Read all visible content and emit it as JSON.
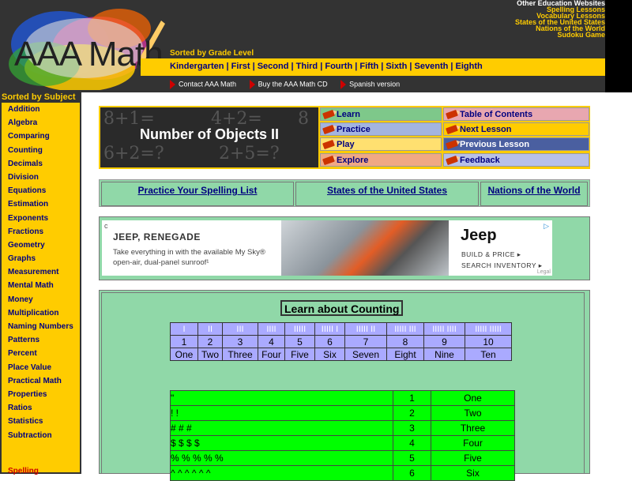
{
  "top": {
    "logo_text": "AAA Math",
    "edu_links": [
      "Other Education Websites",
      "Spelling Lessons",
      "Vocabulary Lessons",
      "States of the United States",
      "Nations of the World",
      "Sudoku Game"
    ],
    "grade_title": "Sorted by Grade Level",
    "grades": [
      "Kindergarten",
      "First",
      "Second",
      "Third",
      "Fourth",
      "Fifth",
      "Sixth",
      "Seventh",
      "Eighth"
    ],
    "subnav": [
      "Contact AAA Math",
      "Buy the AAA Math CD",
      "Spanish version"
    ]
  },
  "sidebar": {
    "title": "Sorted by Subject",
    "items": [
      "Addition",
      "Algebra",
      "Comparing",
      "Counting",
      "Decimals",
      "Division",
      "Equations",
      "Estimation",
      "Exponents",
      "Fractions",
      "Geometry",
      "Graphs",
      "Measurement",
      "Mental Math",
      "Money",
      "Multiplication",
      "Naming Numbers",
      "Patterns",
      "Percent",
      "Place Value",
      "Practical Math",
      "Properties",
      "Ratios",
      "Statistics",
      "Subtraction"
    ],
    "spelling": "Spelling"
  },
  "header": {
    "title": "Number of Objects II",
    "chalk": [
      "8+1=",
      "4+2=",
      "6+2=?",
      "2+5=?",
      "8"
    ],
    "buttons": [
      {
        "label": "Learn",
        "color": "#7ec88a"
      },
      {
        "label": "Table of Contents",
        "color": "#e8a7b0"
      },
      {
        "label": "Practice",
        "color": "#a3b4e0"
      },
      {
        "label": "Next Lesson",
        "color": "#ffcc00"
      },
      {
        "label": "Play",
        "color": "#ffe070"
      },
      {
        "label": "Previous Lesson",
        "color": "#4a5fa0"
      },
      {
        "label": "Explore",
        "color": "#f0a884"
      },
      {
        "label": "Feedback",
        "color": "#b8c0e8"
      }
    ]
  },
  "spelling_links": [
    "Practice Your Spelling List",
    "States of the United States",
    "Nations of the World"
  ],
  "ad": {
    "title": "JEEP, RENEGADE",
    "description": "Take everything in with the available My Sky® open-air, dual-panel sunroof¹",
    "brand": "Jeep",
    "link1": "BUILD & PRICE ▸",
    "link2": "SEARCH INVENTORY ▸",
    "legal": "Legal"
  },
  "lesson": {
    "title": "Learn about Counting",
    "tally": [
      "I",
      "II",
      "III",
      "IIII",
      "IIIII",
      "IIIII I",
      "IIIII II",
      "IIIII III",
      "IIIII IIII",
      "IIIII IIIII"
    ],
    "numbers": [
      "1",
      "2",
      "3",
      "4",
      "5",
      "6",
      "7",
      "8",
      "9",
      "10"
    ],
    "words": [
      "One",
      "Two",
      "Three",
      "Four",
      "Five",
      "Six",
      "Seven",
      "Eight",
      "Nine",
      "Ten"
    ],
    "symbol_rows": [
      {
        "symbols": "\"",
        "number": "1",
        "word": "One"
      },
      {
        "symbols": "! !",
        "number": "2",
        "word": "Two"
      },
      {
        "symbols": "# # #",
        "number": "3",
        "word": "Three"
      },
      {
        "symbols": "$ $ $ $",
        "number": "4",
        "word": "Four"
      },
      {
        "symbols": "% % % % %",
        "number": "5",
        "word": "Five"
      },
      {
        "symbols": "^ ^ ^ ^ ^ ^",
        "number": "6",
        "word": "Six"
      }
    ]
  }
}
